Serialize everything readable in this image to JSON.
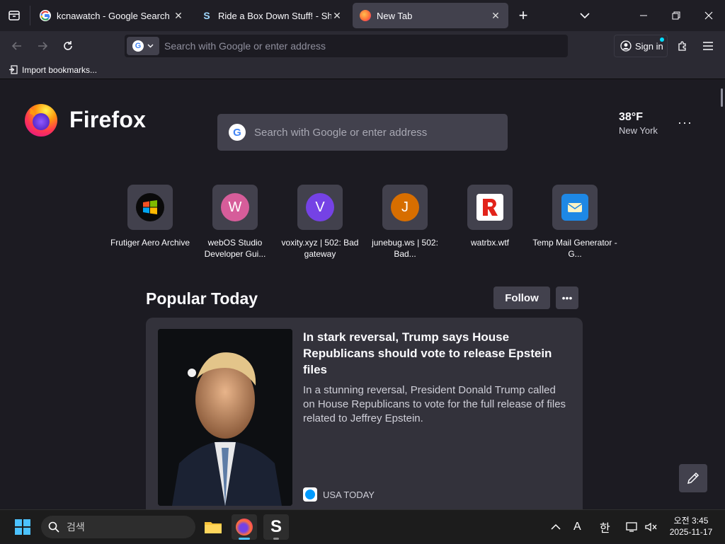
{
  "tabs": [
    {
      "title": "kcnawatch - Google Search",
      "favicon": "google-icon"
    },
    {
      "title": "Ride a Box Down Stuff! - Shklu",
      "favicon": "s-logo-icon"
    },
    {
      "title": "New Tab",
      "favicon": "firefox-icon",
      "active": true
    }
  ],
  "navbar": {
    "url_placeholder": "Search with Google or enter address",
    "sign_in_label": "Sign in"
  },
  "bookmarks": {
    "import_label": "Import bookmarks..."
  },
  "newtab": {
    "brand": "Firefox",
    "search_placeholder": "Search with Google or enter address",
    "weather": {
      "temp": "38°F",
      "city": "New York"
    },
    "shortcuts": [
      {
        "label": "Frutiger Aero Archive",
        "letter": "",
        "color": "#0a0a0a"
      },
      {
        "label": "webOS Studio Developer Gui...",
        "letter": "W",
        "color": "#d65d9a"
      },
      {
        "label": "voxity.xyz | 502: Bad gateway",
        "letter": "V",
        "color": "#7542e5"
      },
      {
        "label": "junebug.ws | 502: Bad...",
        "letter": "J",
        "color": "#d76e00"
      },
      {
        "label": "watrbx.wtf",
        "letter": "",
        "color": "#ffffff"
      },
      {
        "label": "Temp Mail Generator - G...",
        "letter": "",
        "color": "#1e88e5"
      }
    ],
    "section_title": "Popular Today",
    "follow_label": "Follow",
    "story": {
      "headline": "In stark reversal, Trump says House Republicans should vote to release Epstein files",
      "excerpt": "In a stunning reversal, President Donald Trump called on House Republicans to vote for the full release of files related to Jeffrey Epstein.",
      "source": "USA TODAY"
    }
  },
  "taskbar": {
    "search_placeholder": "검색",
    "tray": {
      "ime_a": "A",
      "ime_han": "한"
    },
    "time": "오전 3:45",
    "date": "2025-11-17"
  }
}
